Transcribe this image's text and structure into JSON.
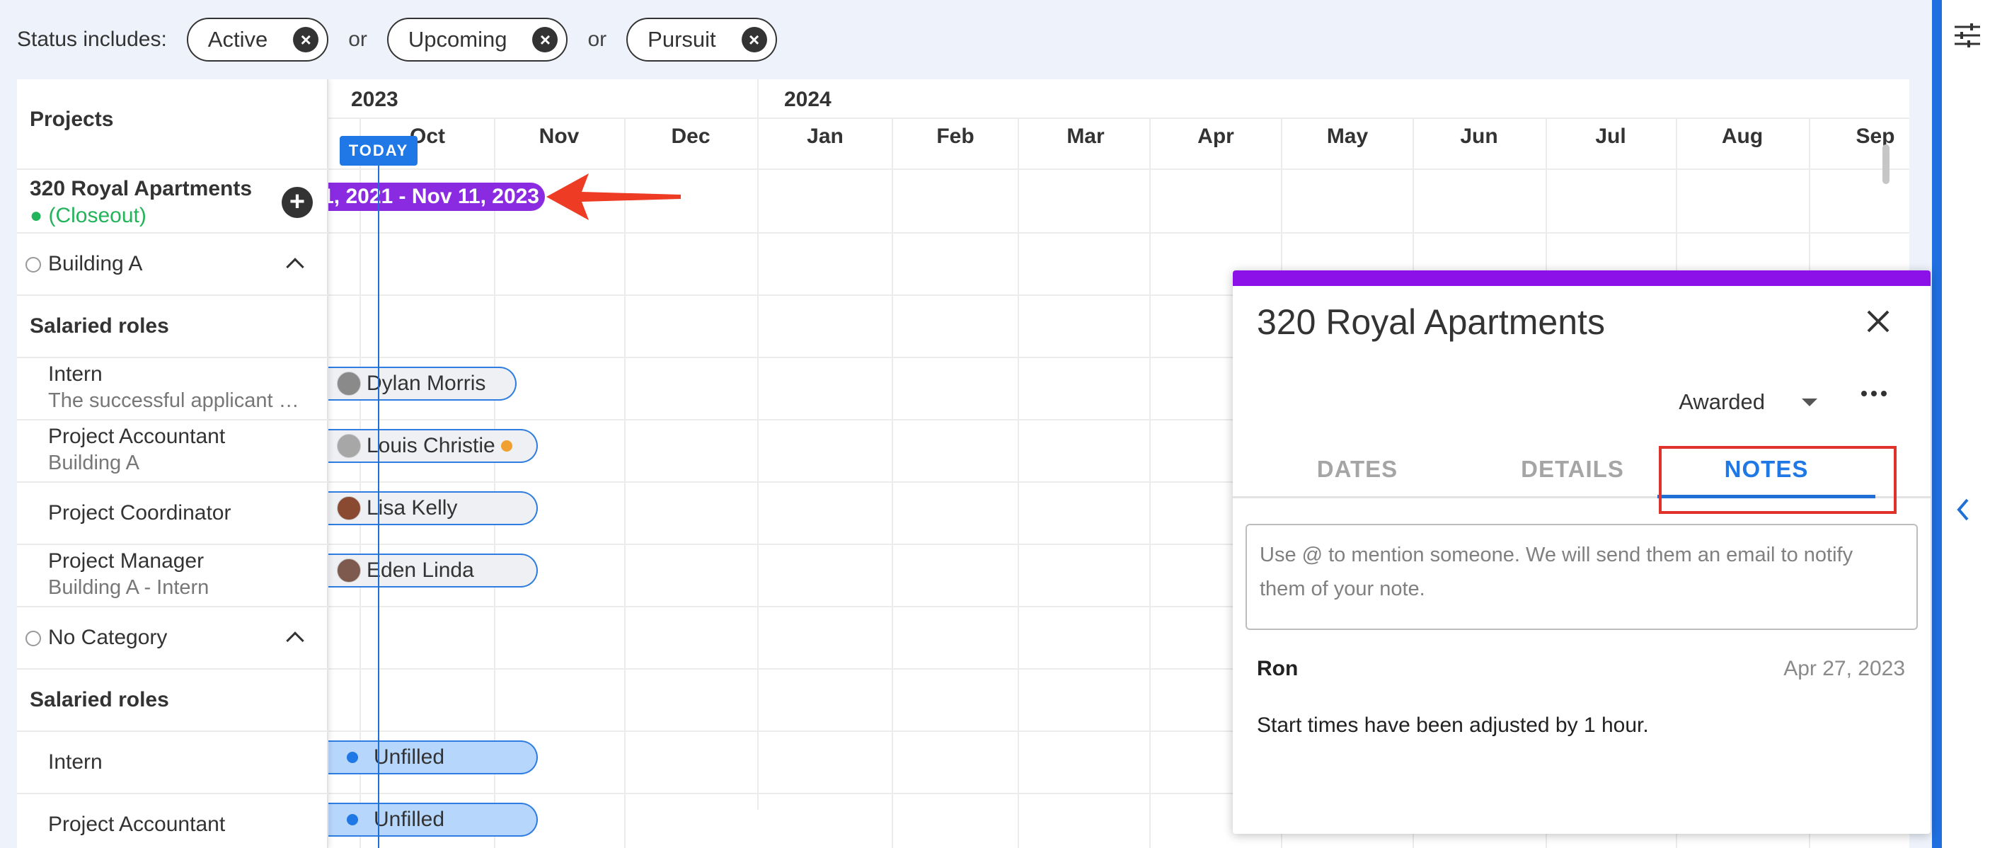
{
  "filters": {
    "label": "Status includes:",
    "chips": [
      "Active",
      "Upcoming",
      "Pursuit"
    ],
    "separator": "or"
  },
  "left": {
    "header": "Projects",
    "project": {
      "name": "320 Royal Apartments",
      "status": "● (Closeout)"
    },
    "building_a": "Building A",
    "salaried_roles_1": "Salaried roles",
    "roles": [
      {
        "title": "Intern",
        "sub": "The successful applicant will..."
      },
      {
        "title": "Project Accountant",
        "sub": "Building A"
      },
      {
        "title": "Project Coordinator",
        "sub": ""
      },
      {
        "title": "Project Manager",
        "sub": "Building A - Intern"
      }
    ],
    "no_category": "No Category",
    "salaried_roles_2": "Salaried roles",
    "roles2": [
      "Intern",
      "Project Accountant"
    ]
  },
  "timeline": {
    "years": [
      "2023",
      "2024"
    ],
    "months": [
      "Oct",
      "Nov",
      "Dec",
      "Jan",
      "Feb",
      "Mar",
      "Apr",
      "May",
      "Jun",
      "Jul",
      "Aug",
      "Sep"
    ],
    "today": "TODAY",
    "project_bar": "1, 2021 - Nov 11, 2023",
    "assignments": [
      "Dylan Morris",
      "Louis Christie",
      "Lisa Kelly",
      "Eden Linda"
    ],
    "unfilled": [
      "Unfilled",
      "Unfilled"
    ]
  },
  "card": {
    "title": "320 Royal Apartments",
    "status": "Awarded",
    "tabs": [
      "DATES",
      "DETAILS",
      "NOTES"
    ],
    "active_tab": "NOTES",
    "note_placeholder": "Use @ to mention someone. We will send them an email to notify them of your note.",
    "note": {
      "author": "Ron",
      "date": "Apr 27, 2023",
      "body": "Start times have been adjusted by 1 hour."
    }
  },
  "colors": {
    "accent": "#1f6fd6",
    "project_bar": "#8a2be2",
    "card_top": "#8c10e8",
    "highlight": "#e0312b",
    "closeout": "#23b35a"
  }
}
